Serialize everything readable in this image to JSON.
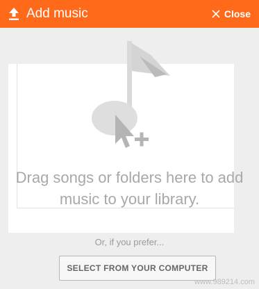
{
  "header": {
    "title": "Add music",
    "close_label": "Close",
    "background_color": "#ff6a1a",
    "upload_icon": "upload-icon",
    "close_icon": "close-icon"
  },
  "dropzone": {
    "icon": "music-note-with-cursor-plus-icon",
    "message": "Drag songs or folders here to add music to your library."
  },
  "alternate": {
    "prefer_text": "Or, if you prefer...",
    "select_button_label": "SELECT FROM YOUR COMPUTER"
  },
  "watermark": "www.989214.com"
}
